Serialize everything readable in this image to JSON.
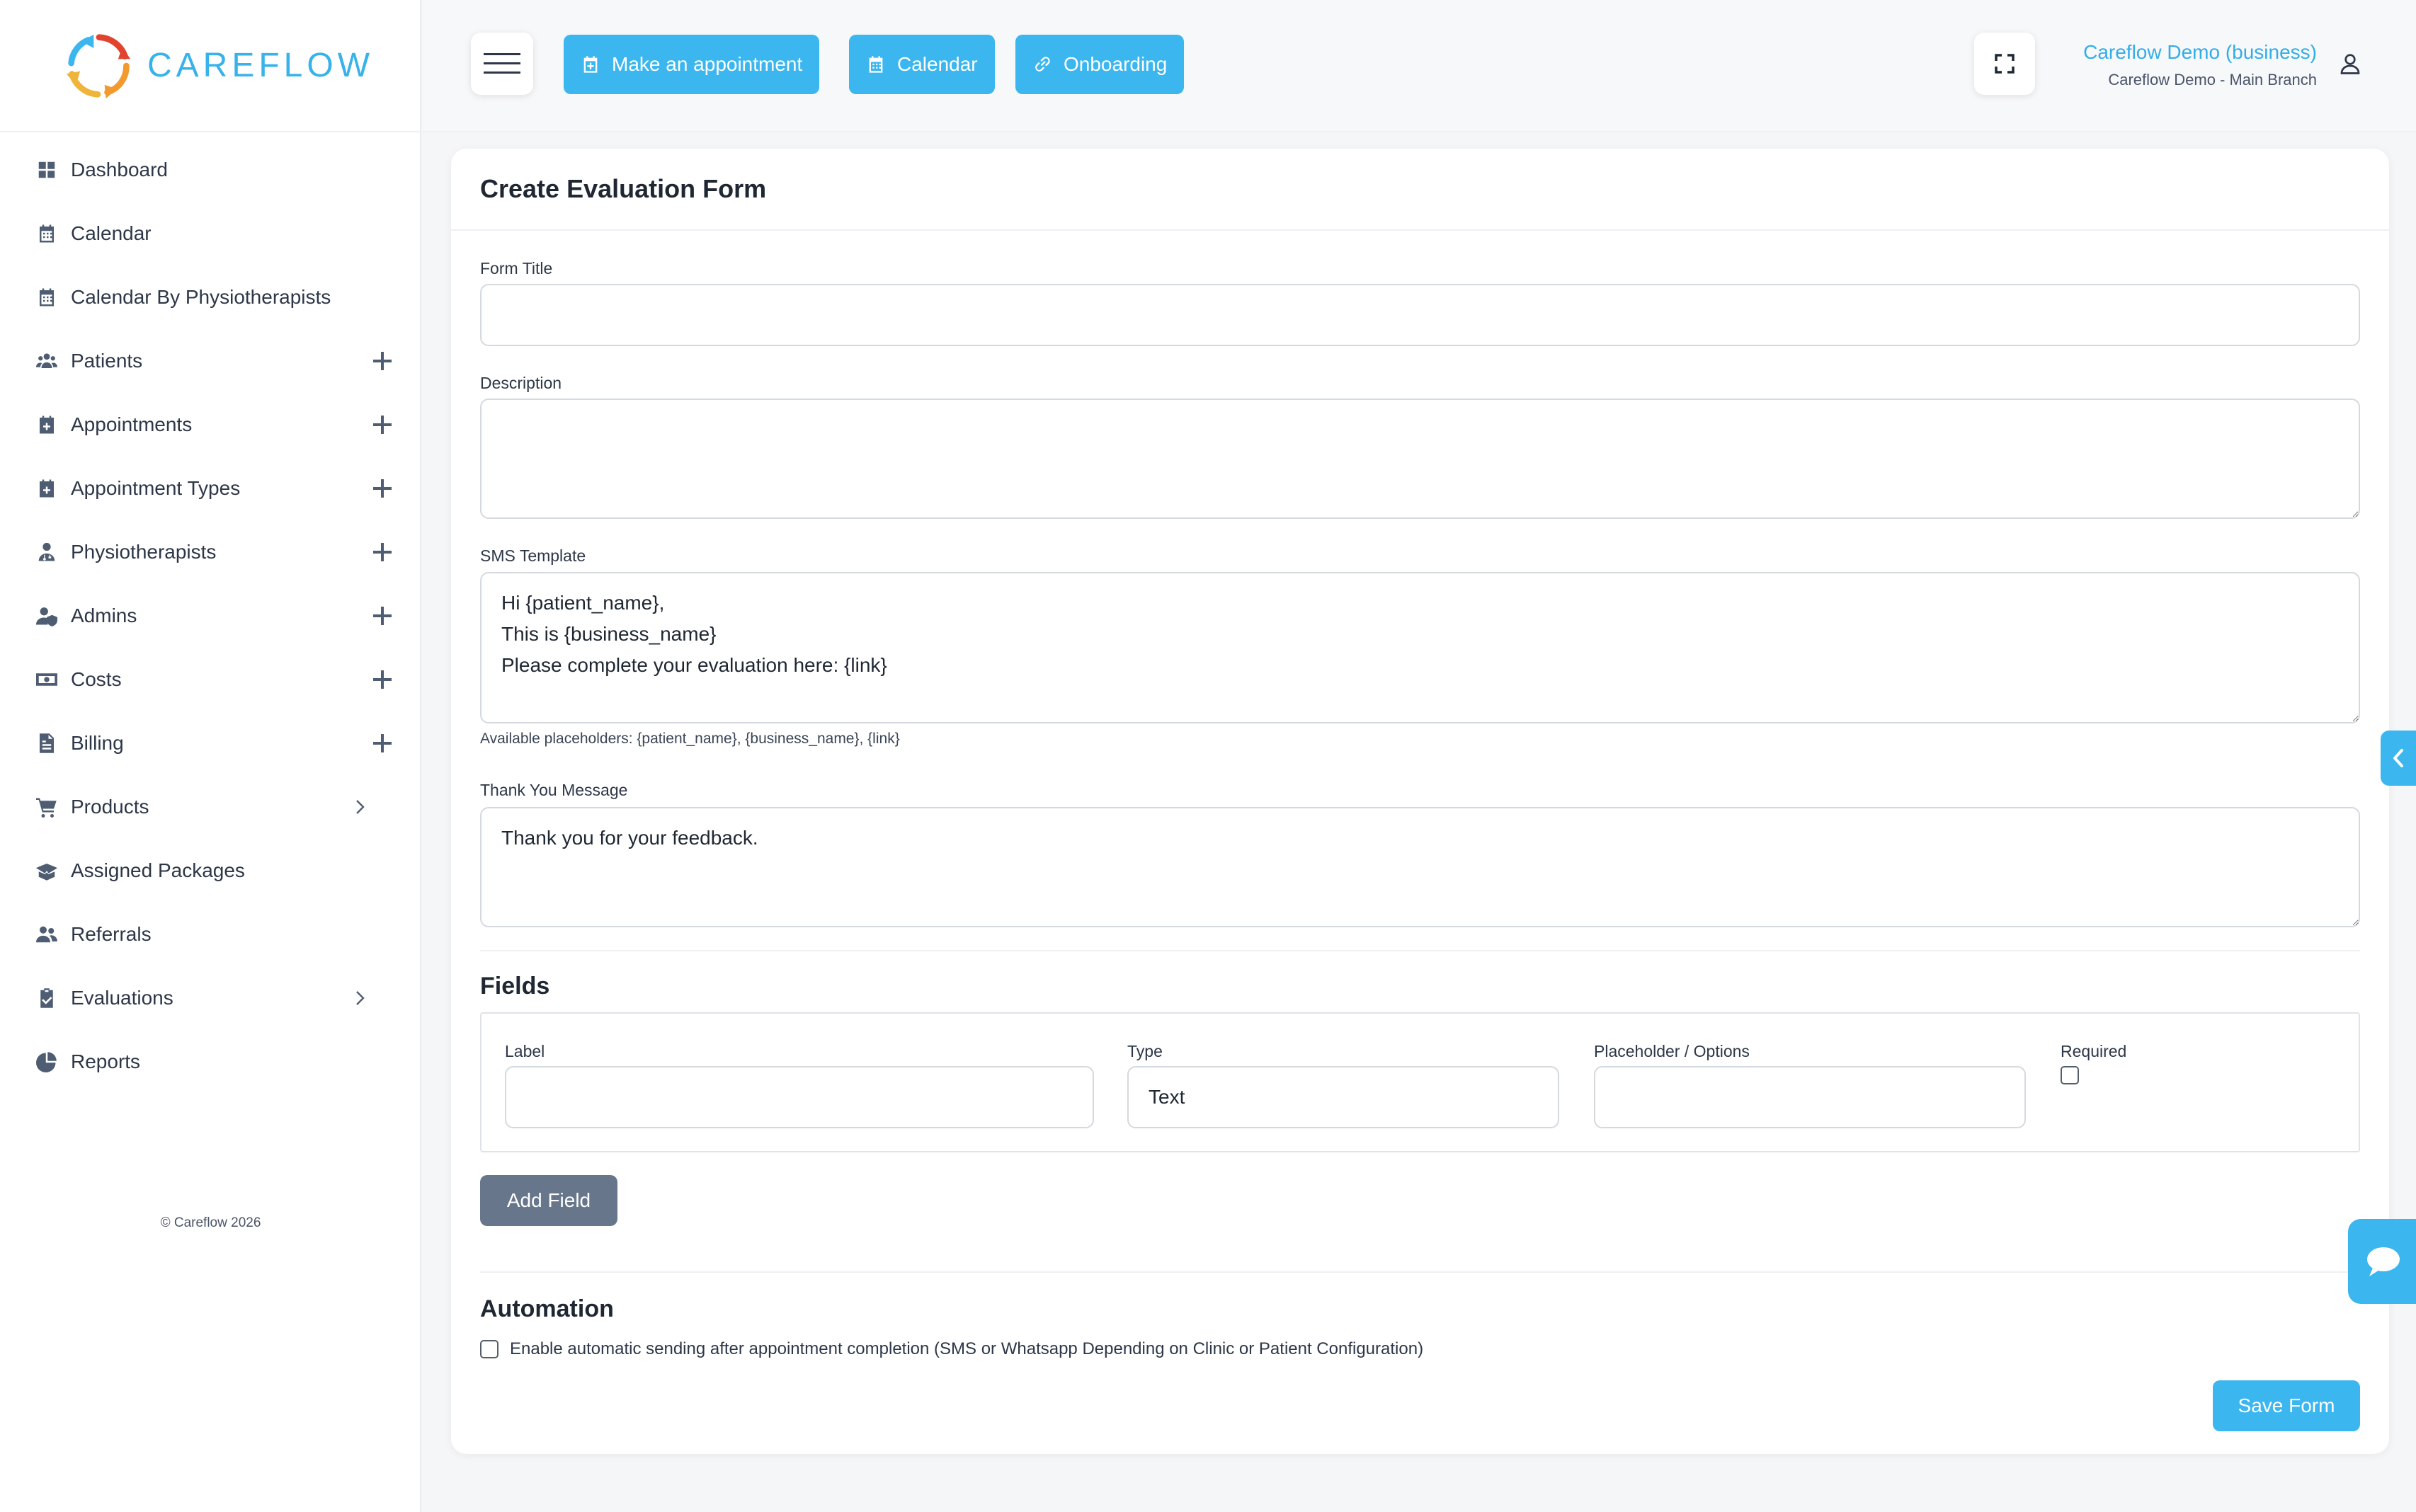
{
  "brand": {
    "name": "CAREFLOW",
    "colors": {
      "accent": "#3bb6ef",
      "logo_red": "#e2432e",
      "logo_orange": "#f29a2e",
      "logo_blue": "#3bb6ef"
    }
  },
  "sidebar": {
    "items": [
      {
        "label": "Dashboard",
        "icon": "grid-icon",
        "control": ""
      },
      {
        "label": "Calendar",
        "icon": "calendar-icon",
        "control": ""
      },
      {
        "label": "Calendar By Physiotherapists",
        "icon": "calendar-icon",
        "control": ""
      },
      {
        "label": "Patients",
        "icon": "users-icon",
        "control": "plus"
      },
      {
        "label": "Appointments",
        "icon": "calendar-plus-icon",
        "control": "plus"
      },
      {
        "label": "Appointment Types",
        "icon": "calendar-plus-icon",
        "control": "plus"
      },
      {
        "label": "Physiotherapists",
        "icon": "doctor-icon",
        "control": "plus"
      },
      {
        "label": "Admins",
        "icon": "user-shield-icon",
        "control": "plus"
      },
      {
        "label": "Costs",
        "icon": "money-icon",
        "control": "plus"
      },
      {
        "label": "Billing",
        "icon": "invoice-icon",
        "control": "plus"
      },
      {
        "label": "Products",
        "icon": "cart-icon",
        "control": "chevron"
      },
      {
        "label": "Assigned Packages",
        "icon": "box-open-icon",
        "control": ""
      },
      {
        "label": "Referrals",
        "icon": "user-group-icon",
        "control": ""
      },
      {
        "label": "Evaluations",
        "icon": "clipboard-check-icon",
        "control": "chevron"
      },
      {
        "label": "Reports",
        "icon": "pie-chart-icon",
        "control": ""
      }
    ],
    "copyright": "© Careflow 2026"
  },
  "topbar": {
    "buttons": {
      "make_appointment": "Make an appointment",
      "calendar": "Calendar",
      "onboarding": "Onboarding"
    },
    "user": {
      "name": "Careflow Demo (business)",
      "branch": "Careflow Demo - Main Branch"
    }
  },
  "form": {
    "title": "Create Evaluation Form",
    "form_title_label": "Form Title",
    "form_title_value": "",
    "description_label": "Description",
    "description_value": "",
    "sms_label": "SMS Template",
    "sms_value": "Hi {patient_name},\nThis is {business_name}\nPlease complete your evaluation here: {link}",
    "sms_hint": "Available placeholders: {patient_name}, {business_name}, {link}",
    "thanks_label": "Thank You Message",
    "thanks_value": "Thank you for your feedback.",
    "fields_title": "Fields",
    "field_row": {
      "label_header": "Label",
      "type_header": "Type",
      "type_value": "Text",
      "placeholder_header": "Placeholder / Options",
      "required_header": "Required"
    },
    "add_field_label": "Add Field",
    "automation_title": "Automation",
    "automation_label": "Enable automatic sending after appointment completion (SMS or Whatsapp Depending on Clinic or Patient Configuration)",
    "save_label": "Save Form"
  }
}
